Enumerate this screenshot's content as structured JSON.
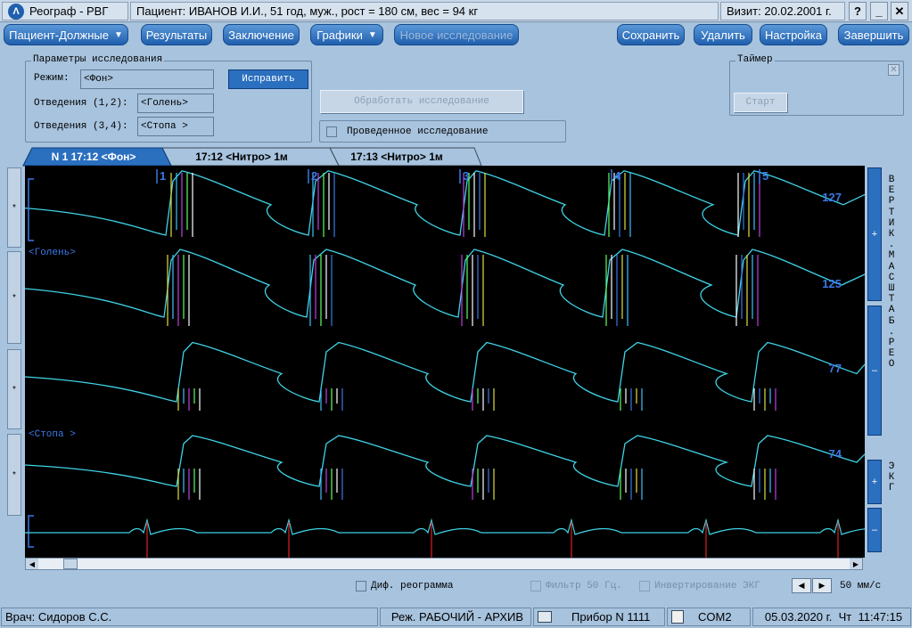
{
  "title": {
    "app": "Реограф - РВГ",
    "patient": "Пациент:  ИВАНОВ И.И., 51 год, муж., рост = 180 см, вес = 94 кг",
    "visit": "Визит:  20.02.2001 г.",
    "help": "?",
    "minimize": "_",
    "close": "✕"
  },
  "toolbar": {
    "patient": "Пациент-Должные",
    "results": "Результаты",
    "conclusion": "Заключение",
    "graphs": "Графики",
    "new_study": "Новое исследование",
    "save": "Сохранить",
    "delete": "Удалить",
    "settings": "Настройка",
    "exit": "Завершить"
  },
  "params": {
    "title": "Параметры исследования",
    "mode_label": "Режим:",
    "mode_value": "<Фон>",
    "fix": "Исправить",
    "lead12_label": "Отведения (1,2):",
    "lead12_value": "<Голень>",
    "lead34_label": "Отведения (3,4):",
    "lead34_value": "<Стопа >"
  },
  "process_btn": "Обработать исследование",
  "done_study": "Проведенное исследование",
  "timer": {
    "title": "Таймер",
    "start": "Старт"
  },
  "tabs": [
    "N 1  17:12  <Фон>",
    "17:12  <Нитро> 1м",
    "17:13  <Нитро> 1м"
  ],
  "chart": {
    "lead_a": "<Голень>",
    "lead_b": "<Стопа >",
    "values": [
      "127",
      "125",
      "77",
      "74"
    ],
    "markers": [
      "1",
      "2",
      "3",
      "4",
      "5"
    ]
  },
  "left_marks": [
    "*",
    "*",
    "*",
    "*"
  ],
  "right": {
    "plus1": "+",
    "minus1": "–",
    "vert_label": "ВЕРТИК.МАСШТАБ.РЕО",
    "plus2": "+",
    "minus2": "–",
    "ekg_label": "ЭКГ"
  },
  "bottom": {
    "diff": "Диф. реограмма",
    "filter": "Фильтр 50 Гц.",
    "invert": "Инвертирование ЭКГ",
    "speed": "50 мм/с",
    "left": "◀",
    "right": "▶"
  },
  "status": {
    "doctor": "Врач: Сидоров С.С.",
    "mode": "Реж. РАБОЧИЙ - АРХИВ",
    "device": "Прибор N 1111",
    "port": "COM2",
    "date": "05.03.2020 г.",
    "day": "Чт",
    "time": "11:47:15"
  },
  "colors": {
    "trace": "#3fd3e6",
    "ekg": "#3fd3e6",
    "ekg_mark": "#e02020",
    "label": "#3a78e6",
    "accent": "#1f5fae"
  }
}
